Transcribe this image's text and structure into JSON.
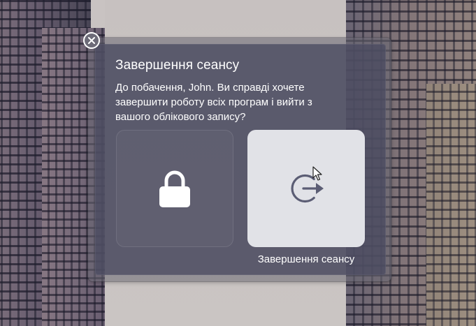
{
  "dialog": {
    "title": "Завершення сеансу",
    "message": "До побачення, John. Ви справді хочете завершити роботу всіх програм і вийти з вашого облікового запису?",
    "close_icon": "close-icon",
    "options": [
      {
        "id": "lock",
        "icon": "lock-icon",
        "label": "",
        "highlighted": false
      },
      {
        "id": "log-out",
        "icon": "log-out-icon",
        "label": "Завершення сеансу",
        "highlighted": true
      }
    ]
  },
  "colors": {
    "dialog_bg": "#4a4a60",
    "highlight_bg": "#e1e2e7",
    "logout_icon": "#5b5d74",
    "text": "#ffffff"
  }
}
